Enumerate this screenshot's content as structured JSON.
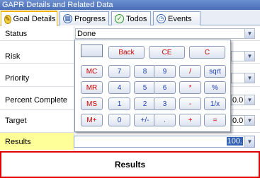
{
  "window": {
    "title": "GAPR Details and Related Data"
  },
  "tabs": [
    {
      "label": "Goal Details",
      "icon": "goal-icon"
    },
    {
      "label": "Progress",
      "icon": "progress-icon"
    },
    {
      "label": "Todos",
      "icon": "todos-icon"
    },
    {
      "label": "Events",
      "icon": "events-icon"
    }
  ],
  "form": {
    "status": {
      "label": "Status",
      "value": "Done"
    },
    "risk": {
      "label": "Risk"
    },
    "priority": {
      "label": "Priority"
    },
    "percent_complete": {
      "label": "Percent Complete",
      "value": "0.0"
    },
    "target": {
      "label": "Target",
      "value": "0.0"
    },
    "results": {
      "label": "Results",
      "value": "100."
    }
  },
  "calculator": {
    "buttons": {
      "back": "Back",
      "ce": "CE",
      "c": "C",
      "mc": "MC",
      "mr": "MR",
      "ms": "MS",
      "mplus": "M+",
      "n7": "7",
      "n8": "8",
      "n9": "9",
      "div": "/",
      "sqrt": "sqrt",
      "n4": "4",
      "n5": "5",
      "n6": "6",
      "mul": "*",
      "pct": "%",
      "n1": "1",
      "n2": "2",
      "n3": "3",
      "minus": "-",
      "recip": "1/x",
      "n0": "0",
      "sign": "+/-",
      "dot": ".",
      "plus": "+",
      "eq": "="
    }
  },
  "footer": {
    "label": "Results"
  },
  "colors": {
    "highlight": "#ffff99",
    "footer_border": "#e00000",
    "operator_text": "#cc0000",
    "digit_text": "#1f3fb0"
  }
}
